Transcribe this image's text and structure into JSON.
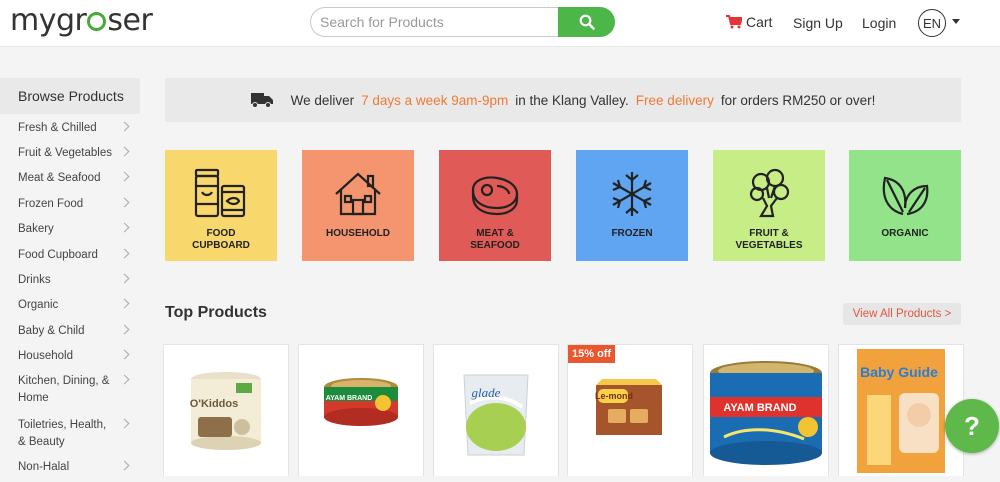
{
  "header": {
    "logo": {
      "pre": "mygr",
      "post": "ser"
    },
    "search_placeholder": "Search for Products",
    "cart": "Cart",
    "sign_up": "Sign Up",
    "login": "Login",
    "language": "EN"
  },
  "sidebar": {
    "title": "Browse Products",
    "items": [
      "Fresh & Chilled",
      "Fruit & Vegetables",
      "Meat & Seafood",
      "Frozen Food",
      "Bakery",
      "Food Cupboard",
      "Drinks",
      "Organic",
      "Baby & Child",
      "Household",
      "Kitchen, Dining, & Home",
      "Toiletries, Health, & Beauty",
      "Non-Halal"
    ]
  },
  "banner": {
    "text1": "We deliver",
    "highlight1": "7 days a week 9am-9pm",
    "text2": "in the Klang Valley.",
    "highlight2": "Free delivery",
    "text3": "for orders RM250 or over!"
  },
  "categories": [
    {
      "line1": "FOOD",
      "line2": "CUPBOARD",
      "color": "#f8d86c",
      "icon": "food-cupboard-icon"
    },
    {
      "line1": "HOUSEHOLD",
      "line2": "",
      "color": "#f4956f",
      "icon": "house-icon"
    },
    {
      "line1": "MEAT &",
      "line2": "SEAFOOD",
      "color": "#e05a57",
      "icon": "steak-icon"
    },
    {
      "line1": "FROZEN",
      "line2": "",
      "color": "#5fa5f2",
      "icon": "snowflake-icon"
    },
    {
      "line1": "FRUIT &",
      "line2": "VEGETABLES",
      "color": "#c6ed86",
      "icon": "broccoli-icon"
    },
    {
      "line1": "ORGANIC",
      "line2": "",
      "color": "#92e38a",
      "icon": "leaves-icon"
    }
  ],
  "top_products": {
    "title": "Top Products",
    "view_all": "View All Products >",
    "items": [
      {
        "image": "O'Kiddos canister",
        "label": "O'Kiddos"
      },
      {
        "image": "Ayam Brand tuna can",
        "label": "AYAM BRAND"
      },
      {
        "image": "Glade gel air freshener",
        "label": "glade"
      },
      {
        "image": "Le-mond biscuits",
        "label": "Le-mond",
        "badge": "15% off"
      },
      {
        "image": "Ayam Brand tuna light can",
        "label": "AYAM BRAND"
      },
      {
        "image": "Baby Guide box",
        "label": "Baby Guide"
      }
    ]
  },
  "help_button": "?"
}
